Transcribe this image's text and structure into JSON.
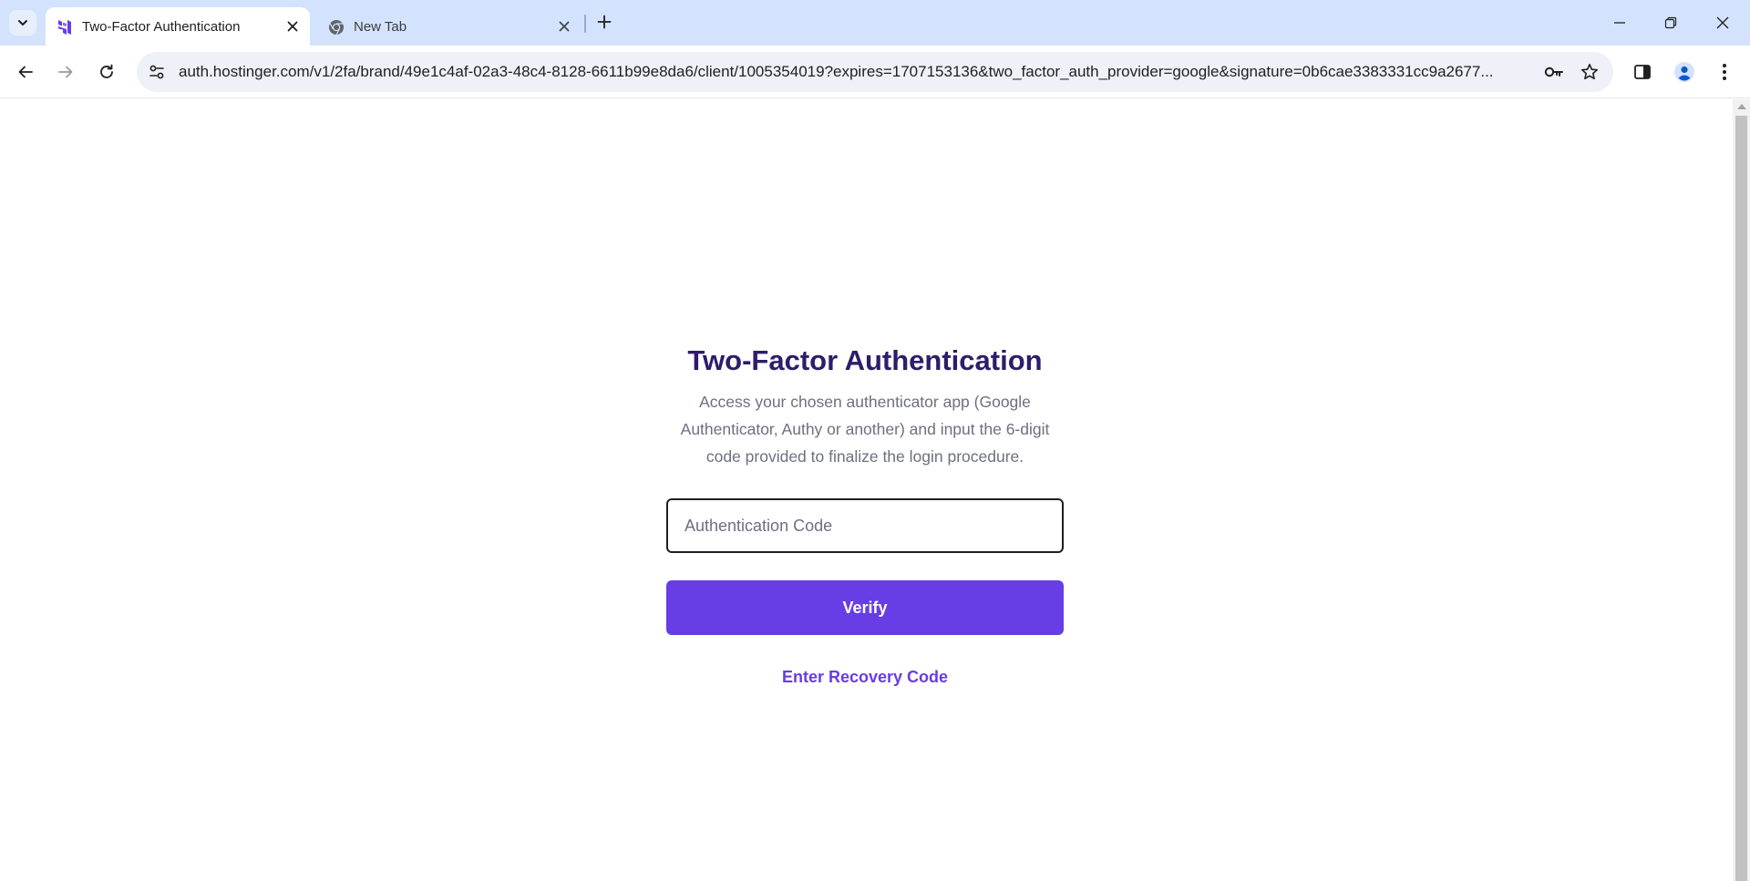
{
  "browser": {
    "tabs": [
      {
        "title": "Two-Factor Authentication",
        "favicon": "hostinger-logo-icon",
        "active": true
      },
      {
        "title": "New Tab",
        "favicon": "chrome-icon",
        "active": false
      }
    ],
    "url": "auth.hostinger.com/v1/2fa/brand/49e1c4af-02a3-48c4-8128-6611b99e8da6/client/1005354019?expires=1707153136&two_factor_auth_provider=google&signature=0b6cae3383331cc9a2677...",
    "accent_color": "#d3e3fd"
  },
  "page": {
    "heading": "Two-Factor Authentication",
    "subtitle": "Access your chosen authenticator app (Google Authenticator, Authy or another) and input the 6-digit code provided to finalize the login procedure.",
    "input_placeholder": "Authentication Code",
    "input_value": "",
    "verify_label": "Verify",
    "recovery_label": "Enter Recovery Code",
    "brand_color": "#673de6",
    "heading_color": "#2f1c6a"
  }
}
